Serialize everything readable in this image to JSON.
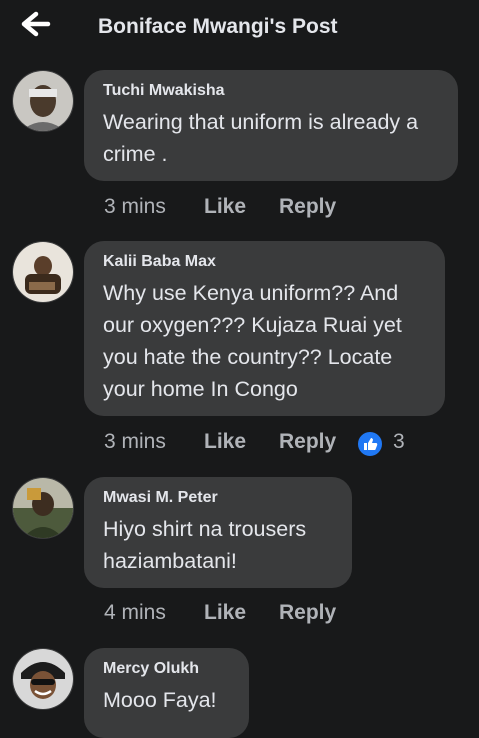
{
  "header": {
    "title": "Boniface Mwangi's Post",
    "back_icon": "arrow-left-icon"
  },
  "colors": {
    "background": "#18191a",
    "bubble": "#3a3b3c",
    "text": "#e4e6eb",
    "muted": "#b0b3b8",
    "like_blue": "#2078f4"
  },
  "comments": [
    {
      "author": "Tuchi Mwakisha",
      "text": "Wearing that uniform is already a crime .",
      "time": "3 mins",
      "like_label": "Like",
      "reply_label": "Reply",
      "reaction_count": ""
    },
    {
      "author": "Kalii Baba Max",
      "text": "Why use Kenya uniform?? And our oxygen??? Kujaza Ruai yet you hate the country?? Locate your home In Congo",
      "time": "3 mins",
      "like_label": "Like",
      "reply_label": "Reply",
      "reaction_count": "3"
    },
    {
      "author": "Mwasi M. Peter",
      "text": "Hiyo shirt na trousers haziambatani!",
      "time": "4 mins",
      "like_label": "Like",
      "reply_label": "Reply",
      "reaction_count": ""
    },
    {
      "author": "Mercy Olukh",
      "text": "Mooo Faya!",
      "time": "",
      "like_label": "",
      "reply_label": "",
      "reaction_count": ""
    }
  ]
}
